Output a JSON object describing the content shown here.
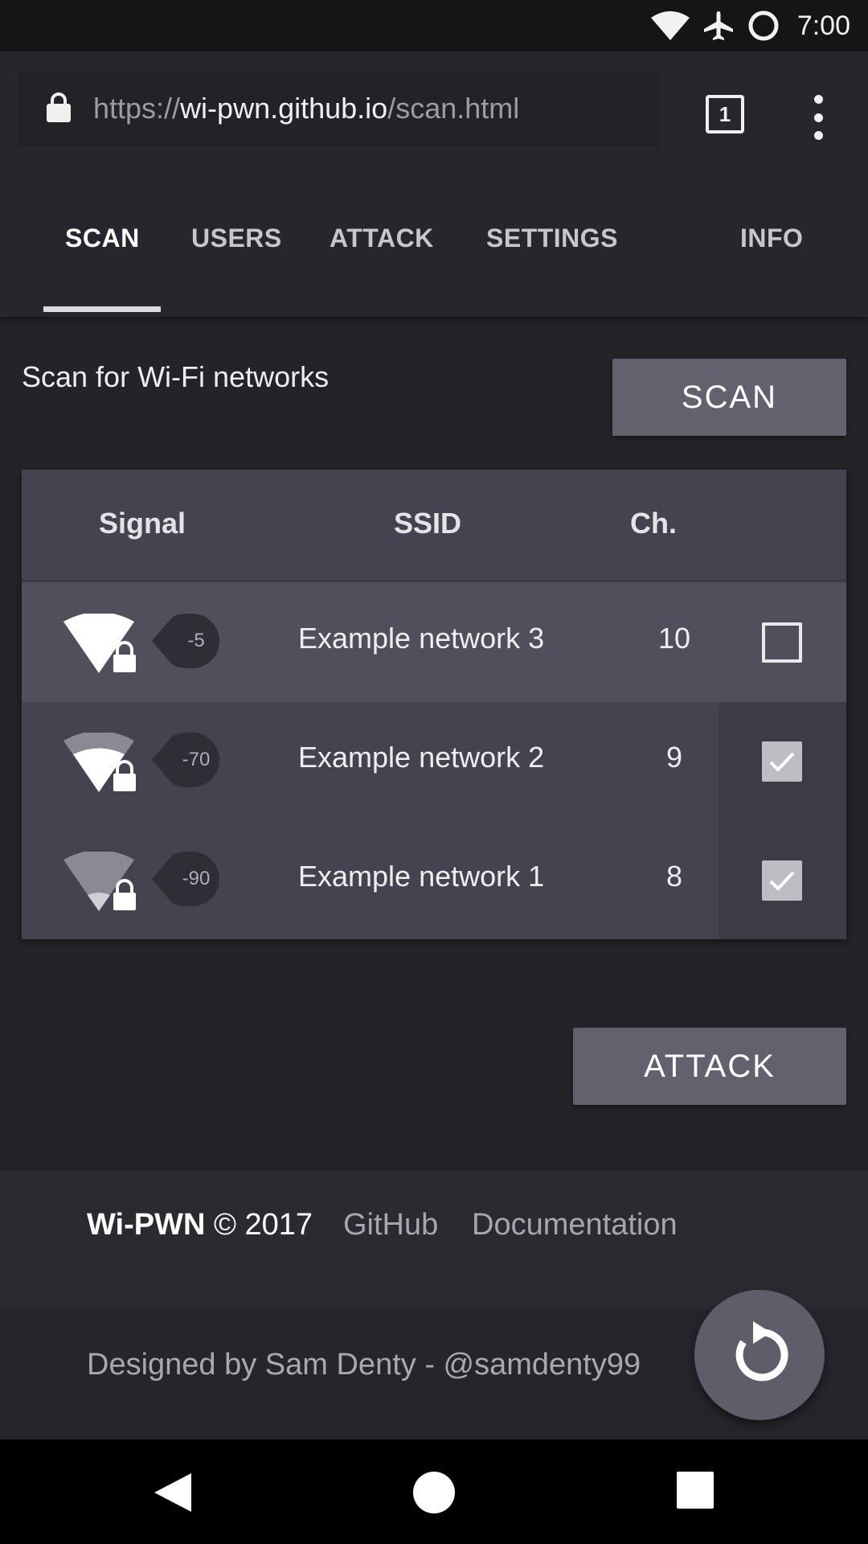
{
  "status_bar": {
    "time": "7:00",
    "icons": [
      "wifi-icon",
      "airplane-icon",
      "data-saver-icon"
    ]
  },
  "browser": {
    "url_scheme": "https://",
    "url_host": "wi-pwn.github.io",
    "url_path": "/scan.html",
    "tab_count": "1"
  },
  "nav": {
    "tabs": [
      {
        "label": "SCAN",
        "active": true
      },
      {
        "label": "USERS"
      },
      {
        "label": "ATTACK"
      },
      {
        "label": "SETTINGS"
      },
      {
        "label": "INFO"
      }
    ]
  },
  "scan": {
    "heading": "Scan for Wi-Fi networks",
    "button_label": "SCAN"
  },
  "table": {
    "headers": {
      "signal": "Signal",
      "ssid": "SSID",
      "channel": "Ch."
    },
    "rows": [
      {
        "rssi": "-5",
        "ssid": "Example network 3",
        "channel": "10",
        "selected": false,
        "signal_level": 4,
        "locked": true
      },
      {
        "rssi": "-70",
        "ssid": "Example network 2",
        "channel": "9",
        "selected": true,
        "signal_level": 2,
        "locked": true
      },
      {
        "rssi": "-90",
        "ssid": "Example network 1",
        "channel": "8",
        "selected": true,
        "signal_level": 1,
        "locked": true
      }
    ]
  },
  "attack_button_label": "ATTACK",
  "footer": {
    "brand": "Wi-PWN",
    "copyright": "© 2017",
    "links": [
      "GitHub",
      "Documentation"
    ],
    "credit": "Designed by Sam Denty - @samdenty99"
  },
  "colors": {
    "background": "#232328",
    "button": "#62626f",
    "table": "#444450",
    "accent": "#d9d9de"
  }
}
